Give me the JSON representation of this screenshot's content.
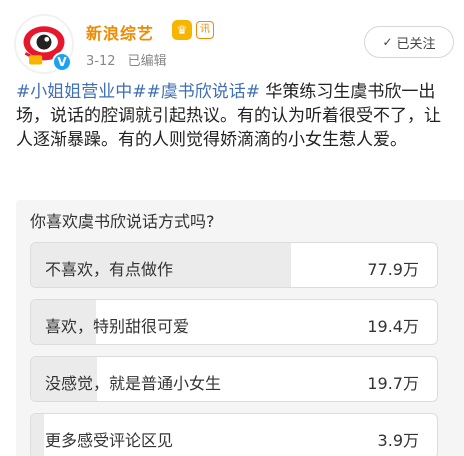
{
  "account": {
    "name": "新浪综艺",
    "badge_crown": "♛",
    "badge_level": "讯",
    "verified": "V",
    "date": "3-12",
    "edited": "已编辑"
  },
  "follow": {
    "label": "已关注",
    "icon": "check-icon"
  },
  "post": {
    "topic1": "#小姐姐营业中#",
    "topic2": "#虞书欣说话#",
    "body": "华策练习生虞书欣一出场，说话的腔调就引起热议。有的认为听着很受不了，让人逐渐暴躁。有的人则觉得娇滴滴的小女生惹人爱。"
  },
  "poll": {
    "question": "你喜欢虞书欣说话方式吗?",
    "options": [
      {
        "label": "不喜欢，有点做作",
        "count": "77.9万",
        "fraction": 0.641
      },
      {
        "label": "喜欢，特别甜很可爱",
        "count": "19.4万",
        "fraction": 0.16
      },
      {
        "label": "没感觉，就是普通小女生",
        "count": "19.7万",
        "fraction": 0.162
      },
      {
        "label": "更多感受评论区见",
        "count": "3.9万",
        "fraction": 0.032
      }
    ]
  },
  "colors": {
    "account_name": "#f08a00",
    "topic": "#3f6fb5",
    "bar_fill": "#ebebeb",
    "verified": "#1da1f2"
  }
}
